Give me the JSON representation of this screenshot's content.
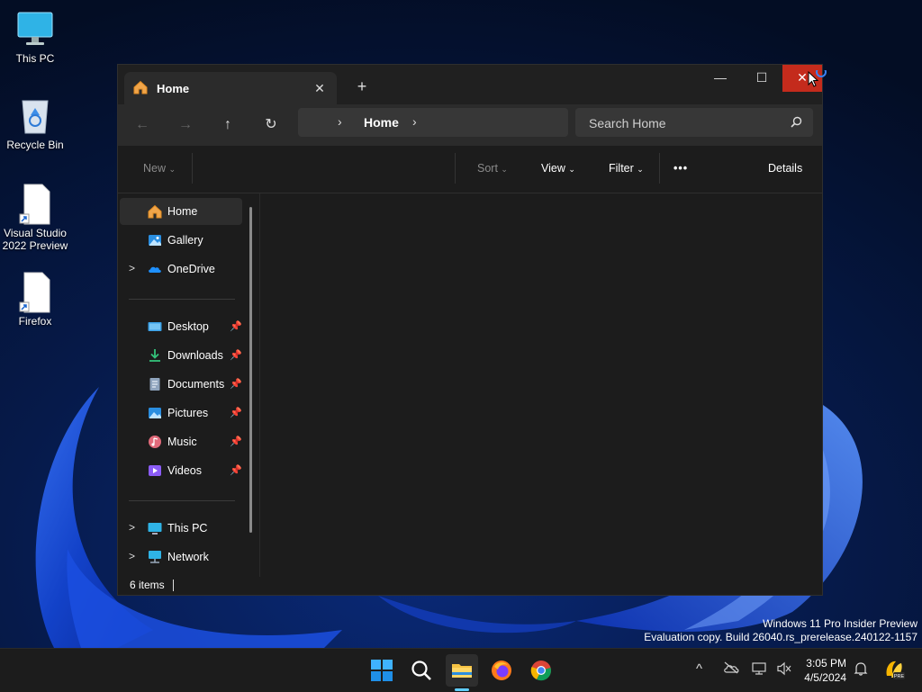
{
  "desktop": {
    "icons": [
      {
        "label": "This PC"
      },
      {
        "label": "Recycle Bin"
      },
      {
        "label": "Visual Studio 2022 Preview"
      },
      {
        "label": "Firefox"
      }
    ],
    "watermark": {
      "line1": "Windows 11 Pro Insider Preview",
      "line2": "Evaluation copy. Build 26040.rs_prerelease.240122-1157"
    }
  },
  "window": {
    "tab_title": "Home",
    "controls": {
      "minimize": "—",
      "maximize": "☐",
      "close": "✕"
    },
    "nav": {
      "back": "←",
      "forward": "→",
      "up": "↑",
      "refresh": "↻"
    },
    "address": {
      "path": "Home",
      "chevron": "›"
    },
    "search": {
      "placeholder": "Search Home"
    },
    "commands": {
      "new": "New",
      "sort": "Sort",
      "view": "View",
      "filter": "Filter",
      "more": "•••",
      "details": "Details"
    },
    "sidebar": {
      "top": [
        {
          "label": "Home",
          "icon": "home-icon",
          "selected": true
        },
        {
          "label": "Gallery",
          "icon": "gallery-icon"
        },
        {
          "label": "OneDrive",
          "icon": "onedrive-icon",
          "expandable": true
        }
      ],
      "quick_access": [
        {
          "label": "Desktop",
          "icon": "desktop-folder-icon"
        },
        {
          "label": "Downloads",
          "icon": "downloads-icon"
        },
        {
          "label": "Documents",
          "icon": "documents-icon"
        },
        {
          "label": "Pictures",
          "icon": "pictures-icon"
        },
        {
          "label": "Music",
          "icon": "music-icon"
        },
        {
          "label": "Videos",
          "icon": "videos-icon"
        }
      ],
      "bottom": [
        {
          "label": "This PC",
          "icon": "this-pc-icon"
        },
        {
          "label": "Network",
          "icon": "network-icon"
        }
      ]
    },
    "status": {
      "items": "6 items"
    }
  },
  "taskbar": {
    "clock": {
      "time": "3:05 PM",
      "date": "4/5/2024"
    },
    "tray_overflow": "^"
  },
  "colors": {
    "accent": "#60cdff",
    "close_red": "#c42b1c",
    "window_bg": "#1c1c1c",
    "desktop_bg": "#04112e"
  }
}
